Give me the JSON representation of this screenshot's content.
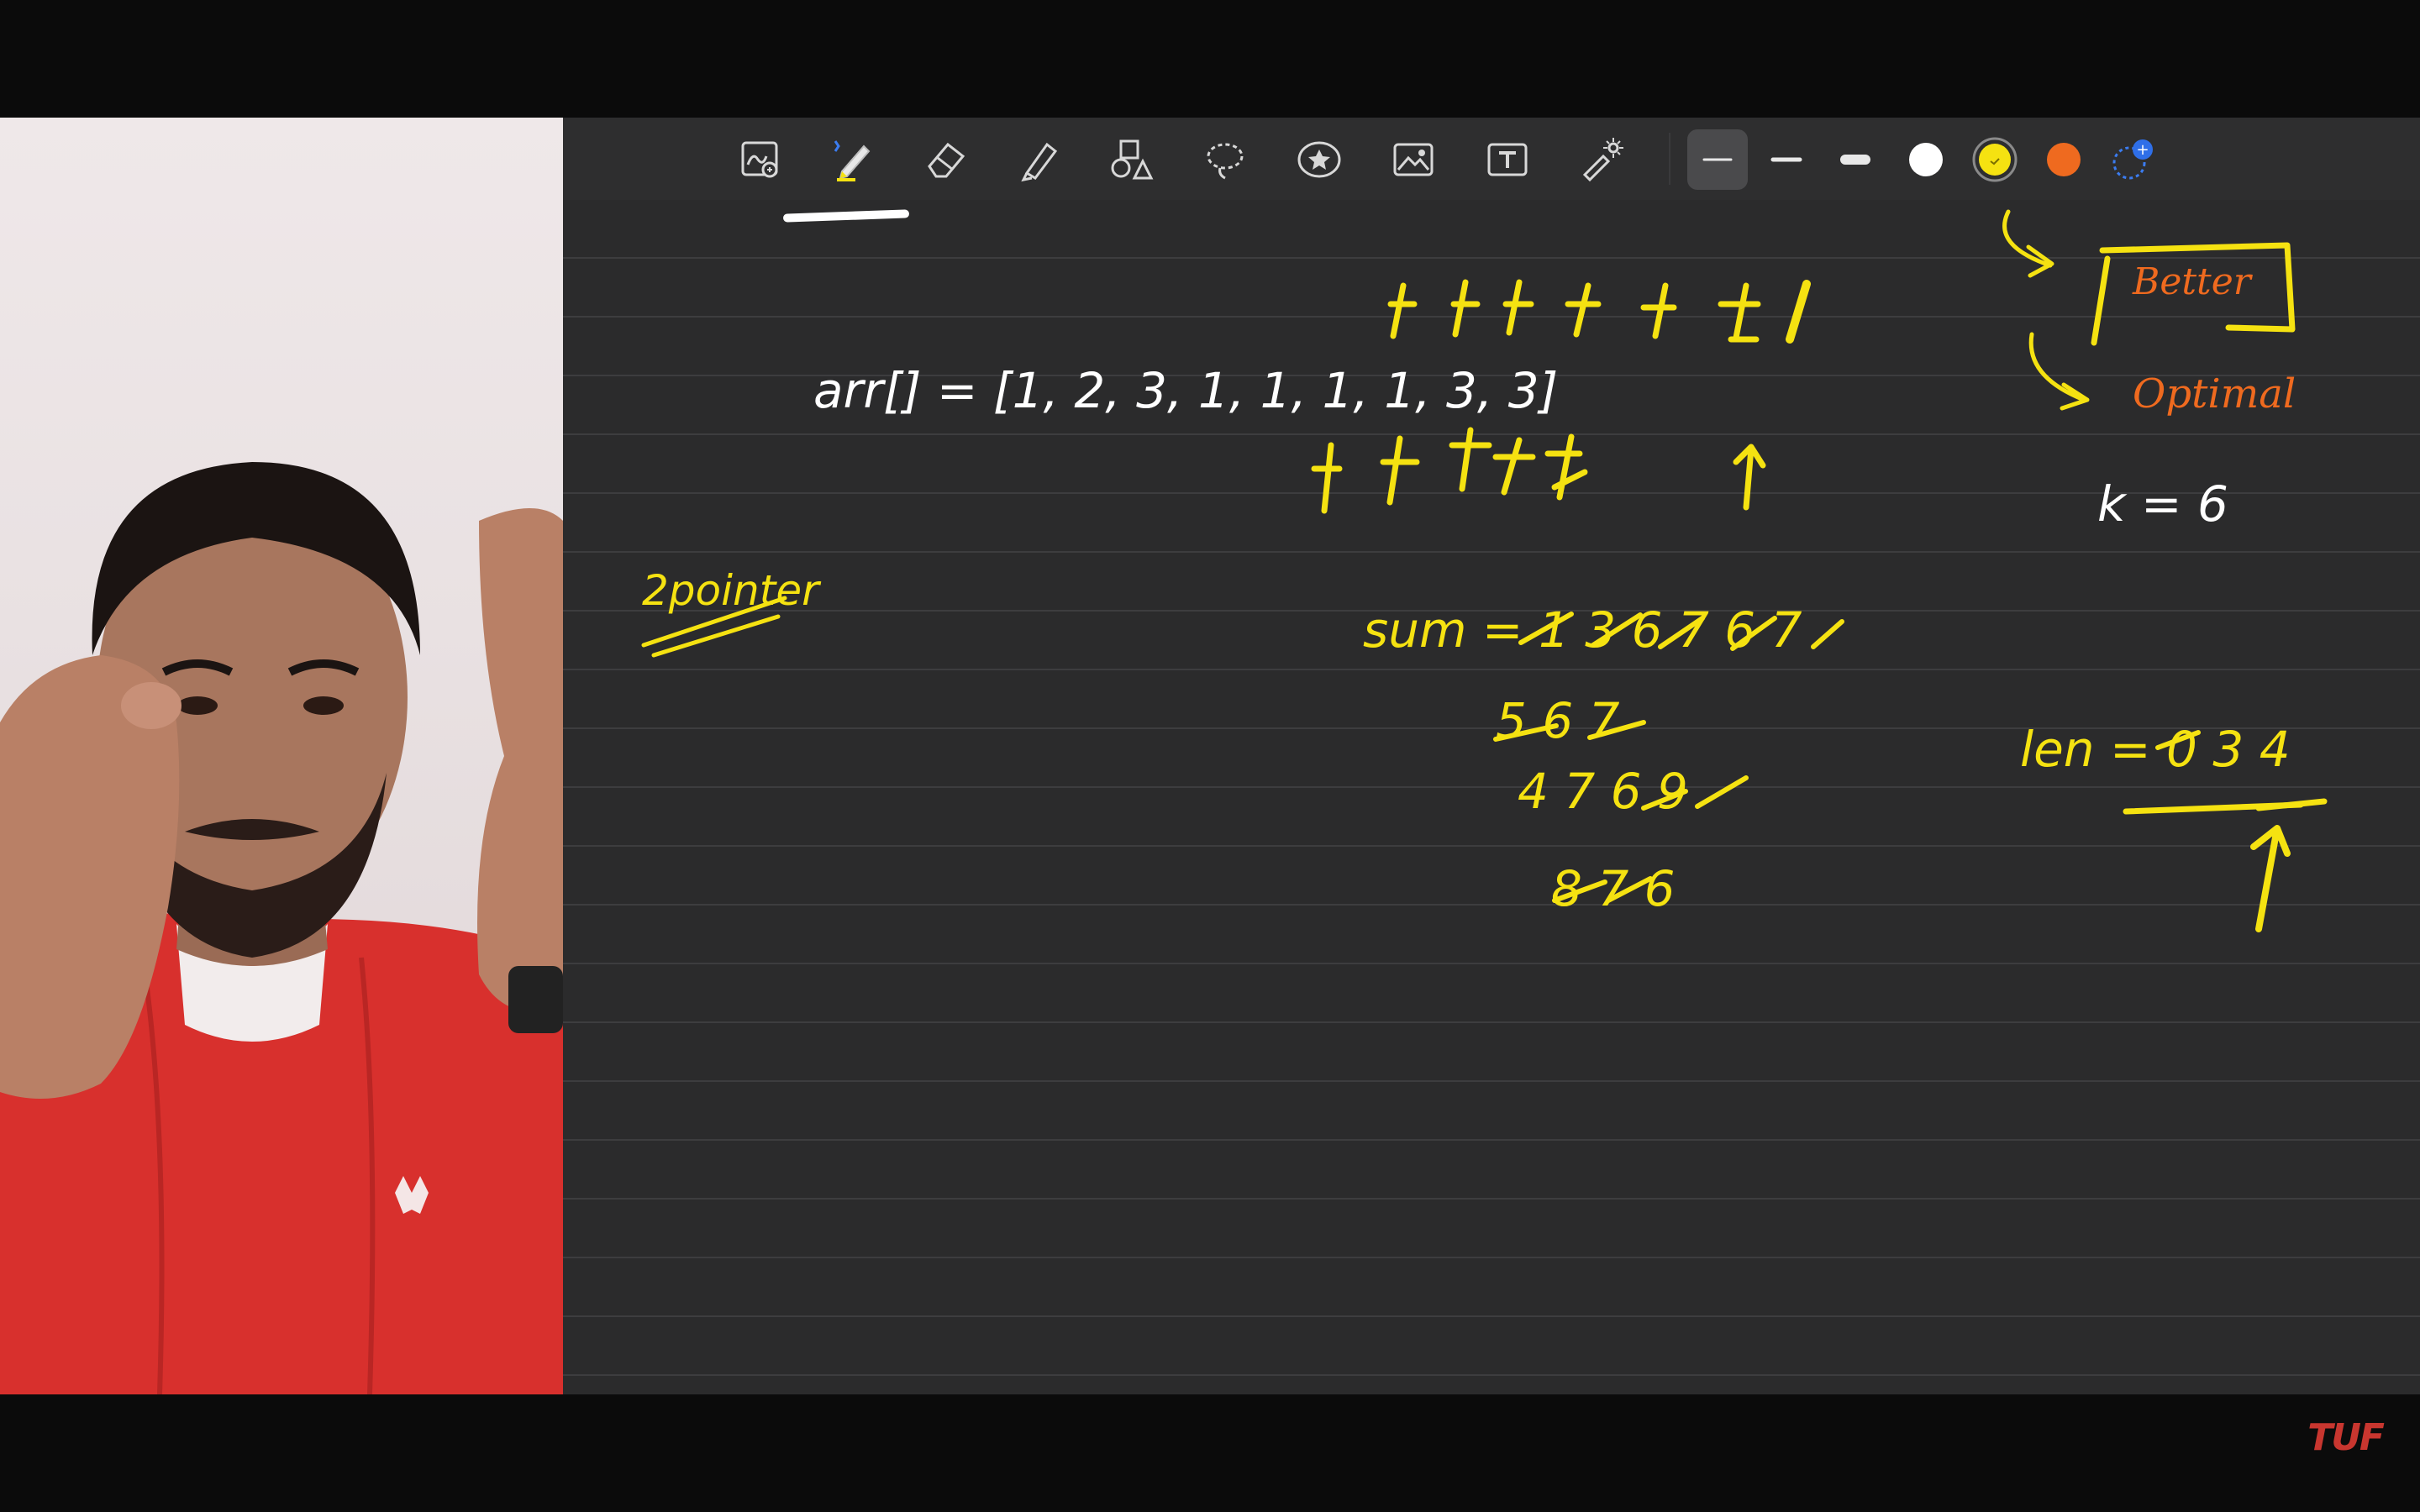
{
  "toolbar": {
    "tools": [
      "zoom-window",
      "pen",
      "eraser",
      "highlighter",
      "shapes",
      "lasso",
      "sticker",
      "image",
      "text",
      "laser-pointer"
    ],
    "active_tool": "pen"
  },
  "pen_options": {
    "line_weights": [
      "thin",
      "medium",
      "thick"
    ],
    "selected_weight": "thin",
    "colors": [
      "#ffffff",
      "#f5e211",
      "#ef6a1f"
    ],
    "selected_color": "#f5e211",
    "add_color_label": "+"
  },
  "notes": {
    "array_line": "arr[] = [1, 2, 3, 1, 1, 1, 1, 3, 3]",
    "label_better": "Better",
    "label_optimal": "Optimal",
    "k_value": "k = 6",
    "two_pointer": "2pointer",
    "sum_line1": "sum = 1 3 6 7 6 7",
    "sum_line2": "5 6 7",
    "sum_line3": "4 7 6 9",
    "sum_line4": "8 7 6",
    "len_line": "len = 0 3 4"
  },
  "brand": {
    "logo_text": "TUF"
  },
  "colors": {
    "ink_yellow": "#f5e211",
    "ink_white": "#ffffff",
    "ink_orange": "#ef6a1f",
    "board_bg": "#2b2b2c",
    "brand_red": "#c8362f"
  }
}
